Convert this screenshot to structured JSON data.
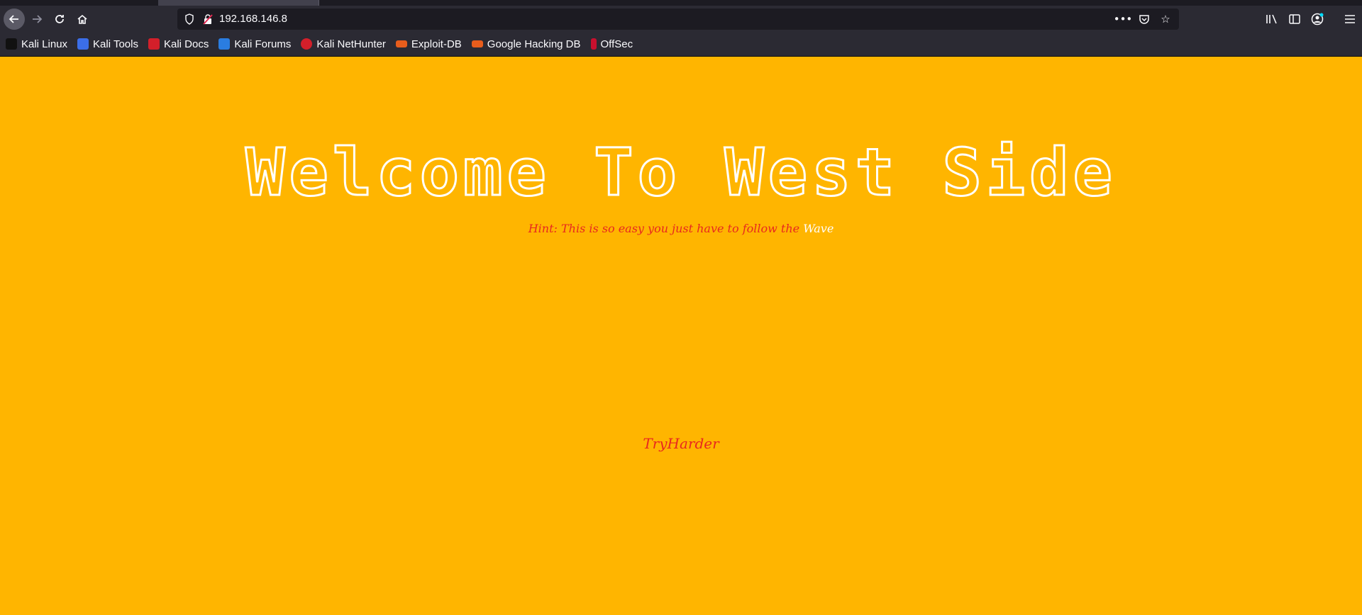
{
  "browser": {
    "url": "192.168.146.8",
    "bookmarks": [
      {
        "label": "Kali Linux",
        "icon": "kali-dragon-icon",
        "color": "#111111"
      },
      {
        "label": "Kali Tools",
        "icon": "kali-tools-icon",
        "color": "#3b6ee8"
      },
      {
        "label": "Kali Docs",
        "icon": "kali-docs-icon",
        "color": "#d31f2a"
      },
      {
        "label": "Kali Forums",
        "icon": "kali-forums-icon",
        "color": "#2a7de1"
      },
      {
        "label": "Kali NetHunter",
        "icon": "kali-nethunter-icon",
        "color": "#d31f2a"
      },
      {
        "label": "Exploit-DB",
        "icon": "exploit-db-icon",
        "color": "#e85d1c"
      },
      {
        "label": "Google Hacking DB",
        "icon": "ghdb-icon",
        "color": "#e85d1c"
      },
      {
        "label": "OffSec",
        "icon": "offsec-icon",
        "color": "#c8102e"
      }
    ]
  },
  "page": {
    "heading": "Welcome To West Side",
    "hint_prefix": "Hint: This is so easy you just have to follow the ",
    "hint_highlight": "Wave",
    "footer_text": "TryHarder",
    "background_color": "#ffb500",
    "hint_color": "#e8281f"
  }
}
